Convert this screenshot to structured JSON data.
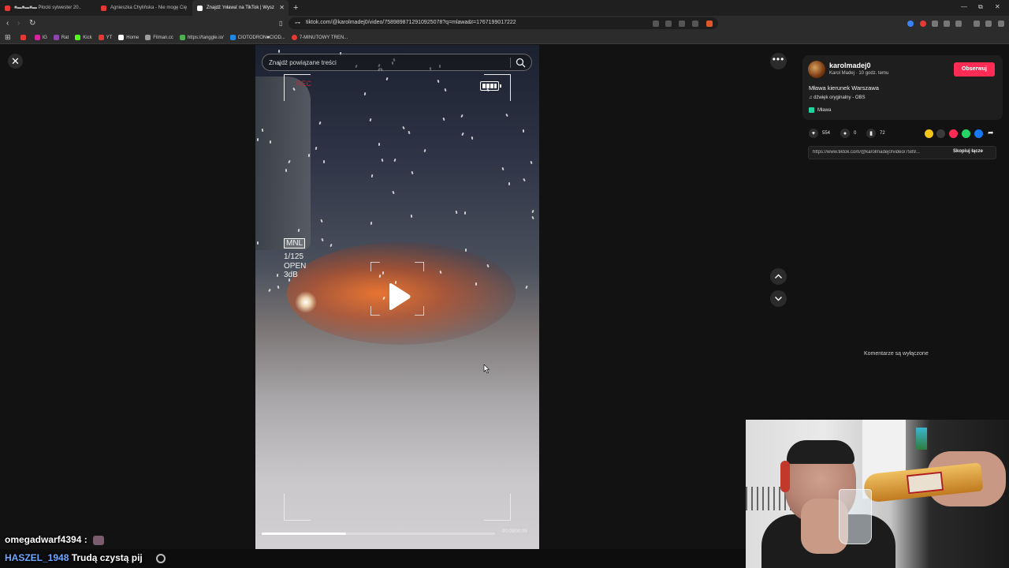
{
  "tabs": [
    {
      "label": "■▬■▬■▬ Płocki sylwester 20..",
      "favicon_color": "#e53935",
      "active": false
    },
    {
      "label": "Agnieszka Chylińska - Nie mogę Cię",
      "favicon_color": "#e53935",
      "active": false
    },
    {
      "label": "Znajdź 'mława' na TikTok | Wysz",
      "favicon_color": "#ffffff",
      "active": true
    }
  ],
  "tab_close_symbol": "✕",
  "new_tab_symbol": "+",
  "window_controls": {
    "minimize": "—",
    "restore": "⧉",
    "close": "✕"
  },
  "address_bar": {
    "url": "tiktok.com/@karolmadej0/video/7589898712910925078?q=mlawa&t=1767199017222"
  },
  "bookmarks": [
    {
      "label": "",
      "color": "#e53935"
    },
    {
      "label": "IG",
      "color": "#d6249f"
    },
    {
      "label": "Rat",
      "color": "#8e44ad"
    },
    {
      "label": "Kick",
      "color": "#53fc18"
    },
    {
      "label": "YT",
      "color": "#e53935"
    },
    {
      "label": "Home",
      "color": "#ffffff"
    },
    {
      "label": "Filman.cc",
      "color": "#9e9e9e"
    },
    {
      "label": "https://tanggle.io/",
      "color": "#4caf50"
    },
    {
      "label": "CIOTODRON■CIOD...",
      "color": "#1e88e5"
    },
    {
      "label": "7-MINUTOWY TREN...",
      "color": "#e53935"
    }
  ],
  "search": {
    "placeholder": "Znajdź powiązane treści"
  },
  "video": {
    "rec_label": "REC",
    "mode_label": "MNL",
    "shutter": "1/125",
    "aperture": "OPEN",
    "gain": "3dB",
    "time": "00:03/00:09",
    "progress": 0.36
  },
  "author": {
    "username": "karolmadej0",
    "subline": "Karol Madej · 10 godz. temu",
    "follow_label": "Obserwuj",
    "description": "Mława kierunek Warszawa",
    "music": "♫ dźwięk oryginalny - OBS",
    "location": "Mława"
  },
  "stats": {
    "likes": "554",
    "comments": "0",
    "saves": "72"
  },
  "share_icons": [
    {
      "name": "emoji-share-icon",
      "color": "#f5c518"
    },
    {
      "name": "embed-share-icon",
      "color": "#3a3a3a"
    },
    {
      "name": "send-share-icon",
      "color": "#fe2c55"
    },
    {
      "name": "whatsapp-share-icon",
      "color": "#25d366"
    },
    {
      "name": "facebook-share-icon",
      "color": "#1877f2"
    }
  ],
  "link": {
    "url": "https://www.tiktok.com/@karolmadej0/video/7589...",
    "copy_label": "Skopiuj łącze"
  },
  "comments_disabled": "Komentarze są wyłączone",
  "chat": {
    "line1_user": "omegadwarf4394 :",
    "line2_user": "HASZEL_1948",
    "line2_text": "Trudą czystą pij"
  },
  "colors": {
    "accent": "#fe2c55",
    "background": "#121212"
  }
}
